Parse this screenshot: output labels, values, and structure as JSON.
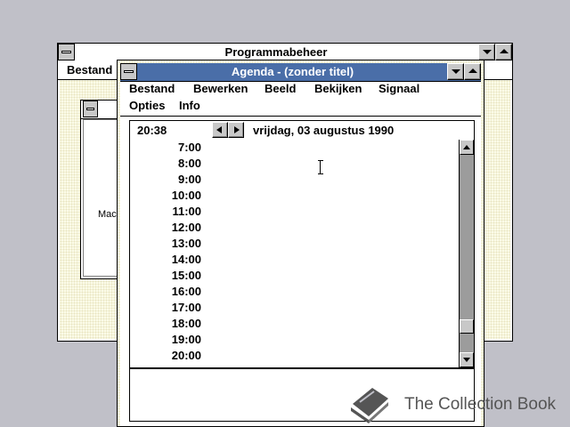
{
  "program_manager": {
    "title": "Programmabeheer",
    "menu": [
      "Bestand"
    ],
    "group_label": "Mac"
  },
  "agenda": {
    "title": "Agenda - (zonder titel)",
    "menu_row1": [
      "Bestand",
      "Bewerken",
      "Beeld",
      "Bekijken",
      "Signaal"
    ],
    "menu_row2": [
      "Opties",
      "Info"
    ],
    "current_time": "20:38",
    "date": "vrijdag, 03 augustus 1990",
    "times": [
      "7:00",
      "8:00",
      "9:00",
      "10:00",
      "11:00",
      "12:00",
      "13:00",
      "14:00",
      "15:00",
      "16:00",
      "17:00",
      "18:00",
      "19:00",
      "20:00"
    ],
    "scroll_position": 0.9
  },
  "watermark": {
    "text": "The Collection Book"
  },
  "colors": {
    "active_title": "#4a6ea8",
    "desktop": "#c0c0c8"
  }
}
